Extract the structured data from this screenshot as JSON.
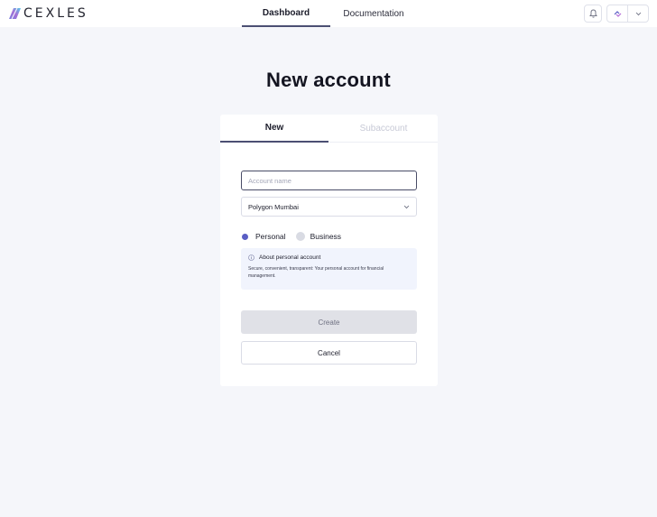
{
  "header": {
    "logo_text": "CEXLES",
    "nav": [
      {
        "label": "Dashboard",
        "active": true
      },
      {
        "label": "Documentation",
        "active": false
      }
    ],
    "icons": {
      "notifications": "bell-icon",
      "account": "account-swap-icon",
      "menu": "chevron-down-icon"
    }
  },
  "main": {
    "title": "New account",
    "tabs": [
      {
        "label": "New",
        "active": true
      },
      {
        "label": "Subaccount",
        "active": false
      }
    ],
    "account_name": {
      "value": "",
      "placeholder": "Account name"
    },
    "network": {
      "selected": "Polygon Mumbai"
    },
    "account_type": {
      "options": [
        {
          "label": "Personal",
          "selected": true
        },
        {
          "label": "Business",
          "selected": false
        }
      ]
    },
    "info": {
      "title": "About personal account",
      "text": "Secure, convenient, transparent: Your personal account for financial management."
    },
    "actions": {
      "create_label": "Create",
      "cancel_label": "Cancel"
    }
  },
  "colors": {
    "accent": "#5a5ec4",
    "tab_underline": "#4b4f73",
    "background": "#f5f6fa",
    "info_bg": "#f1f4fd",
    "disabled_button": "#e0e1e7"
  }
}
